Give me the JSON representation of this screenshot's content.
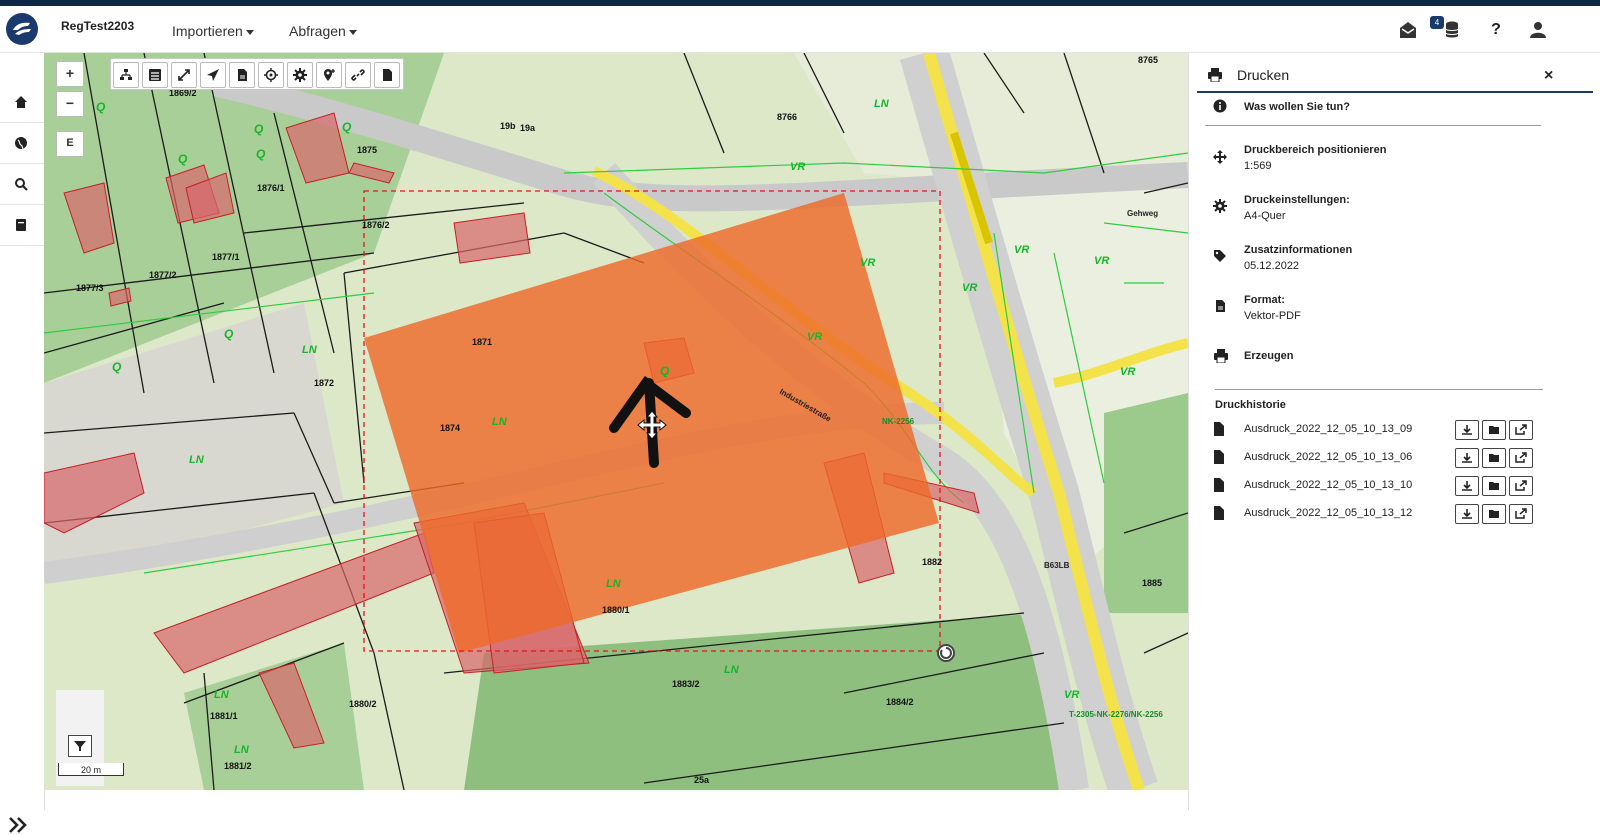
{
  "header": {
    "app_title": "RegTest2203",
    "menus": [
      {
        "label": "Importieren"
      },
      {
        "label": "Abfragen"
      }
    ],
    "notification_count": "4"
  },
  "colors": {
    "brand": "#1a3a6b",
    "print_area": "#ee6a2a",
    "parcel_red": "#d9676b",
    "road_yellow": "#f3e24a",
    "boundary_green": "#2ecc40"
  },
  "map": {
    "scale_label": "20 m",
    "zoom_in": "+",
    "zoom_out": "−",
    "extent_button": "E",
    "parcel_labels": [
      "1869/2",
      "1875",
      "1876/1",
      "1876/2",
      "1877/1",
      "1877/2",
      "1877/3",
      "1871",
      "1872",
      "1874",
      "1880/1",
      "1880/2",
      "1881/1",
      "1881/2",
      "1882",
      "1883/2",
      "1884/2",
      "1885",
      "8766",
      "8765",
      "19b",
      "19a",
      "25a"
    ],
    "landuse_labels": [
      "LN",
      "LN",
      "LN",
      "LN",
      "LN",
      "LN",
      "LN",
      "LN",
      "VR",
      "VR",
      "VR",
      "VR",
      "VR",
      "VR",
      "VR",
      "VR"
    ],
    "annotations": [
      "Q",
      "Q",
      "Q",
      "Q",
      "Q",
      "Q",
      "Q",
      "Q",
      "Gehweg",
      "Industriestraße",
      "B63LB",
      "T-2305-NK-2276/NK-2256",
      "NK-2256"
    ],
    "sidebar_icons": [
      "home-icon",
      "globe-icon",
      "search-icon",
      "book-icon"
    ],
    "toolbar_icons": [
      "tree-icon",
      "list-icon",
      "expand-icon",
      "navigate-icon",
      "document-icon",
      "crosshair-icon",
      "gear-icon",
      "add-location-icon",
      "link-icon",
      "page-icon"
    ]
  },
  "panel": {
    "title": "Drucken",
    "question": "Was wollen Sie tun?",
    "steps": [
      {
        "title": "Druckbereich positionieren",
        "sub": "1:569"
      },
      {
        "title": "Druckeinstellungen:",
        "sub": "A4-Quer"
      },
      {
        "title": "Zusatzinformationen",
        "sub": "05.12.2022"
      },
      {
        "title": "Format:",
        "sub": "Vektor-PDF"
      },
      {
        "title": "Erzeugen",
        "sub": ""
      }
    ],
    "history_title": "Druckhistorie",
    "history": [
      {
        "name": "Ausdruck_2022_12_05_10_13_09"
      },
      {
        "name": "Ausdruck_2022_12_05_10_13_06"
      },
      {
        "name": "Ausdruck_2022_12_05_10_13_10"
      },
      {
        "name": "Ausdruck_2022_12_05_10_13_12"
      }
    ]
  }
}
